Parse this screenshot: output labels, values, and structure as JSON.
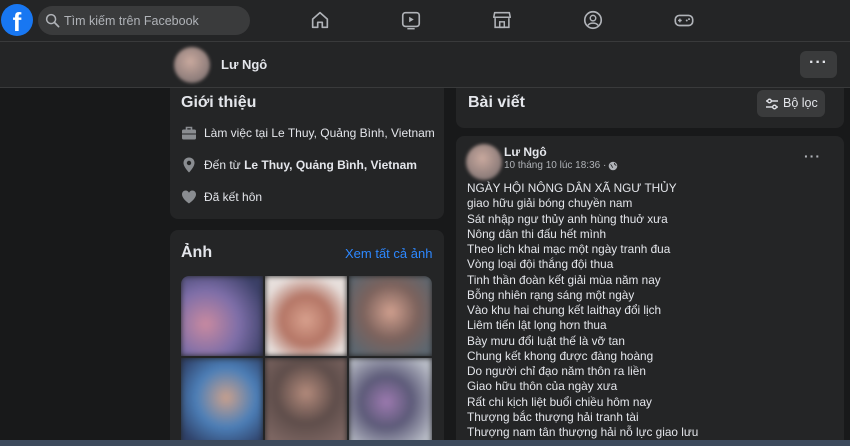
{
  "header": {
    "logo_letter": "f",
    "search_placeholder": "Tìm kiếm trên Facebook",
    "nav_icons": [
      "home-icon",
      "watch-icon",
      "marketplace-icon",
      "groups-icon",
      "gaming-icon"
    ],
    "accent_color": "#1877f2"
  },
  "profile": {
    "name": "Lư Ngô",
    "more_label": "···"
  },
  "intro": {
    "title": "Giới thiệu",
    "items": [
      {
        "icon": "briefcase-icon",
        "prefix": "Làm việc tại ",
        "value": "Le Thuy, Quảng Bình, Vietnam"
      },
      {
        "icon": "location-pin-icon",
        "prefix": "Đến từ ",
        "value": "Le Thuy, Quảng Bình, Vietnam"
      },
      {
        "icon": "heart-icon",
        "prefix": "",
        "value": "Đã kết hôn"
      }
    ]
  },
  "photos": {
    "title": "Ảnh",
    "see_all": "Xem tất cả ảnh"
  },
  "posts_header": {
    "title": "Bài viết",
    "filter_label": "Bộ lọc"
  },
  "post": {
    "author": "Lư Ngô",
    "time": "10 tháng 10 lúc 18:36 ·",
    "menu_label": "···",
    "lines": [
      "NGÀY HỘI NÔNG DÂN XÃ NGƯ THỦY",
      "giao hữu giải bóng chuyền nam",
      "Sát nhập ngư thủy anh hùng thuở xưa",
      "Nông dân thi đấu hết mình",
      "Theo lịch khai mạc một ngày tranh đua",
      "Vòng loại đội thắng đội thua",
      "Tinh thần đoàn kết giải mùa năm nay",
      "Bỗng nhiên rạng sáng một ngày",
      "Vào khu hai chung kết laithay đổi lịch",
      "Liêm tiến lật lọng hơn thua",
      "Bày mưu đổi luật thế là vỡ tan",
      "Chung kết khong được đàng hoàng",
      "Do người chỉ  đạo năm thôn ra liền",
      "Giao hữu thôn của ngày xưa",
      "Rất chi kịch liệt buổi chiều hôm nay",
      "Thượng bắc thượng hải tranh tài",
      "Thượng nam tân thượng hải nỗ lực giao lưu"
    ]
  }
}
